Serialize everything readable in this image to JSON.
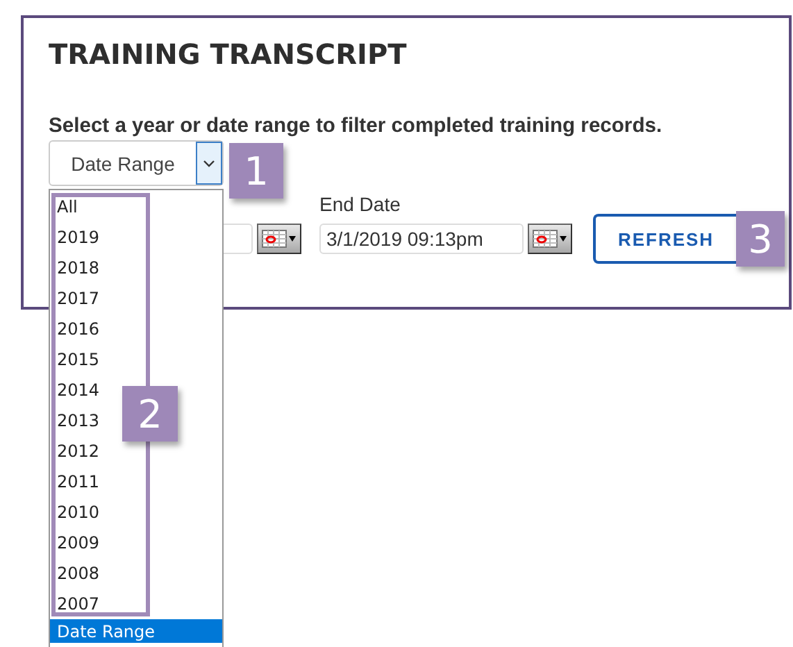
{
  "panel": {
    "title": "TRAINING TRANSCRIPT",
    "instruction": "Select a year or date range to filter completed training records."
  },
  "filter": {
    "value": "Date Range",
    "open": true
  },
  "end_date": {
    "label": "End Date",
    "value": "3/1/2019 09:13pm"
  },
  "refresh_button": {
    "label": "REFRESH"
  },
  "dropdown_options": [
    {
      "label": "All",
      "selected": false
    },
    {
      "label": "2019",
      "selected": false
    },
    {
      "label": "2018",
      "selected": false
    },
    {
      "label": "2017",
      "selected": false
    },
    {
      "label": "2016",
      "selected": false
    },
    {
      "label": "2015",
      "selected": false
    },
    {
      "label": "2014",
      "selected": false
    },
    {
      "label": "2013",
      "selected": false
    },
    {
      "label": "2012",
      "selected": false
    },
    {
      "label": "2011",
      "selected": false
    },
    {
      "label": "2010",
      "selected": false
    },
    {
      "label": "2009",
      "selected": false
    },
    {
      "label": "2008",
      "selected": false
    },
    {
      "label": "2007",
      "selected": false
    },
    {
      "label": "Date Range",
      "selected": true
    }
  ],
  "callouts": [
    {
      "number": "1"
    },
    {
      "number": "2"
    },
    {
      "number": "3"
    }
  ]
}
